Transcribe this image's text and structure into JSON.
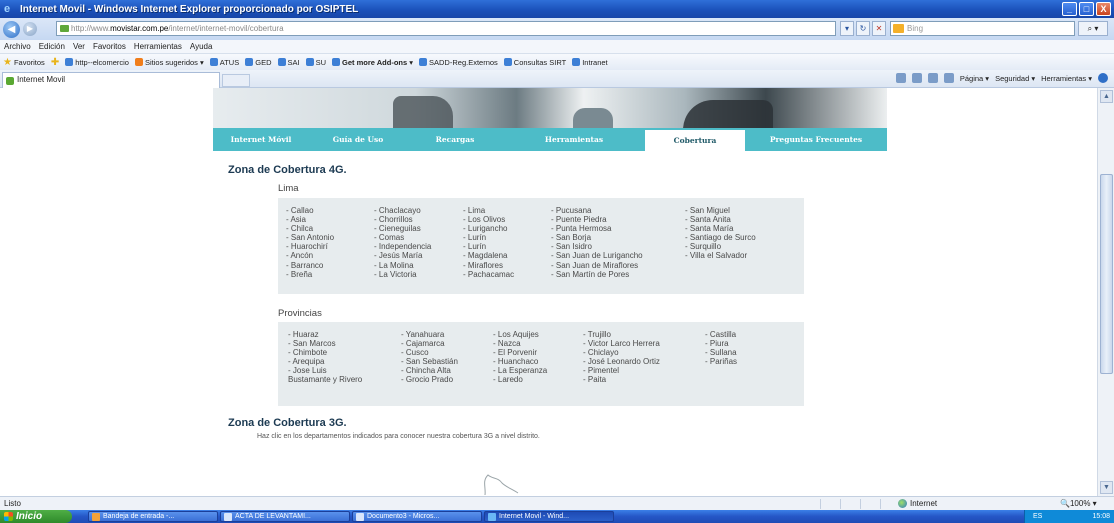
{
  "window": {
    "title": "Internet Movil - Windows Internet Explorer proporcionado por OSIPTEL",
    "minimize": "_",
    "maximize": "□",
    "close": "X"
  },
  "address_bar": {
    "url_prefix": "http://www.",
    "url_domain": "movistar.com.pe",
    "url_path": "/internet/internet-movil/cobertura",
    "search_placeholder": "Bing"
  },
  "menu": [
    "Archivo",
    "Edición",
    "Ver",
    "Favoritos",
    "Herramientas",
    "Ayuda"
  ],
  "favorites_bar": {
    "label": "Favoritos",
    "items": [
      {
        "label": "http--elcomercio"
      },
      {
        "label": "Sitios sugeridos ▾"
      },
      {
        "label": "ATUS"
      },
      {
        "label": "GED"
      },
      {
        "label": "SAI"
      },
      {
        "label": "SU"
      },
      {
        "label": "Get more Add-ons ▾"
      },
      {
        "label": "SADD-Reg.Externos"
      },
      {
        "label": "Consultas SIRT"
      },
      {
        "label": "Intranet"
      }
    ]
  },
  "command_bar": {
    "tab_label": "Internet Movil",
    "items": [
      "Página ▾",
      "Seguridad ▾",
      "Herramientas ▾"
    ]
  },
  "site_nav": {
    "tabs": [
      {
        "label": "Internet Móvil",
        "active": false
      },
      {
        "label": "Guía de Uso",
        "active": false
      },
      {
        "label": "Recargas",
        "active": false
      },
      {
        "label": "Herramientas",
        "active": false
      },
      {
        "label": "Cobertura",
        "active": true
      },
      {
        "label": "Preguntas Frecuentes",
        "active": false
      }
    ]
  },
  "coverage_4g": {
    "heading": "Zona de Cobertura 4G.",
    "lima": {
      "heading": "Lima",
      "columns": [
        [
          "- Callao",
          "- Asia",
          "- Chilca",
          "- San Antonio",
          "- Huarochirí",
          "- Ancón",
          "- Barranco",
          "- Breña"
        ],
        [
          "- Chaclacayo",
          "- Chorrillos",
          "- Cieneguilas",
          "- Comas",
          "- Independencia",
          "- Jesús María",
          "- La Molina",
          "- La Victoria"
        ],
        [
          "- Lima",
          "- Los Olivos",
          "- Lurigancho",
          "- Lurín",
          "- Lurín",
          "- Magdalena",
          "- Miraflores",
          "- Pachacamac"
        ],
        [
          "- Pucusana",
          "- Puente Piedra",
          "- Punta Hermosa",
          "- San Borja",
          "- San Isidro",
          "- San Juan de Lurigancho",
          "- San Juan de Miraflores",
          "- San Martín de Pores"
        ],
        [
          "- San Miguel",
          "- Santa Anita",
          "- Santa María",
          "- Santiago de Surco",
          "- Surquillo",
          "- Villa el Salvador"
        ]
      ]
    },
    "provincias": {
      "heading": "Provincias",
      "columns": [
        [
          "- Huaraz",
          "- San Marcos",
          "- Chimbote",
          "- Arequipa",
          "- Jose Luis",
          "Bustamante y Rivero"
        ],
        [
          "- Yanahuara",
          "- Cajamarca",
          "- Cusco",
          "- San Sebastián",
          "- Chincha Alta",
          "- Grocio Prado"
        ],
        [
          "- Los Aquijes",
          "- Nazca",
          "- El Porvenir",
          "- Huanchaco",
          "- La Esperanza",
          "- Laredo"
        ],
        [
          "- Trujillo",
          "- Victor Larco Herrera",
          "- Chiclayo",
          "- José Leonardo Ortiz",
          "- Pimentel",
          "- Paita"
        ],
        [
          "- Castilla",
          "- Piura",
          "- Sullana",
          "- Pariñas"
        ]
      ]
    }
  },
  "coverage_3g": {
    "heading": "Zona de Cobertura 3G.",
    "note": "Haz clic en los departamentos indicados para conocer nuestra cobertura 3G a nivel distrito."
  },
  "status_bar": {
    "status": "Listo",
    "zone": "Internet",
    "zoom": "100%"
  },
  "taskbar": {
    "start": "Inicio",
    "tasks": [
      {
        "label": "Bandeja de entrada -...",
        "active": false
      },
      {
        "label": "ACTA DE LEVANTAMI...",
        "active": false
      },
      {
        "label": "Documento3 - Micros...",
        "active": false
      },
      {
        "label": "Internet Movil - Wind...",
        "active": true
      }
    ],
    "lang": "ES",
    "clock": "15:08"
  }
}
